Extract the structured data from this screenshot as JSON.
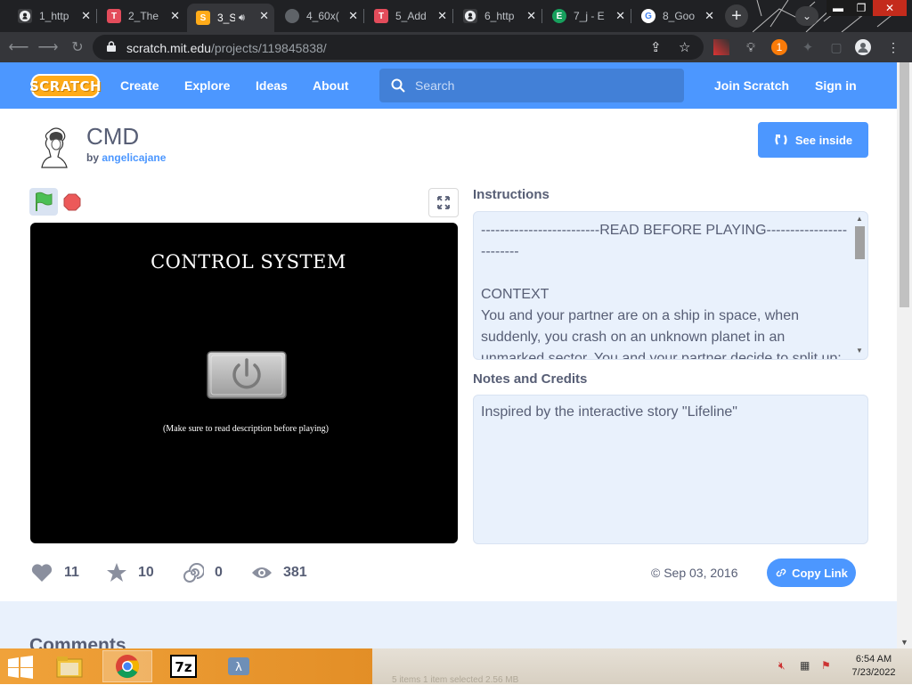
{
  "browser": {
    "tabs": [
      {
        "title": "1_http",
        "favicon": "github-icon",
        "color": "#3c3d40"
      },
      {
        "title": "2_The",
        "favicon": "T",
        "color": "#e34c5b"
      },
      {
        "title": "3_S",
        "favicon": "S",
        "color": "#ffab19",
        "active": true,
        "audio": true
      },
      {
        "title": "4_60x(",
        "favicon": "",
        "color": "#5f6368"
      },
      {
        "title": "5_Add",
        "favicon": "T",
        "color": "#e34c5b"
      },
      {
        "title": "6_http",
        "favicon": "github-icon",
        "color": "#3c3d40"
      },
      {
        "title": "7_j - E",
        "favicon": "E",
        "color": "#17a05d"
      },
      {
        "title": "8_Goo",
        "favicon": "G",
        "color": "#ffffff"
      }
    ],
    "url_host": "scratch.mit.edu",
    "url_path": "/projects/119845838/",
    "extension_badge": "1"
  },
  "scratch_nav": {
    "logo": "SCRATCH",
    "links": [
      "Create",
      "Explore",
      "Ideas",
      "About"
    ],
    "search_placeholder": "Search",
    "join": "Join Scratch",
    "signin": "Sign in"
  },
  "project": {
    "title": "CMD",
    "by_label": "by",
    "author": "angelicajane",
    "see_inside": "See inside",
    "stage": {
      "title": "CONTROL SYSTEM",
      "note": "(Make sure to read description before playing)"
    },
    "instructions_heading": "Instructions",
    "instructions": [
      "-------------------------READ BEFORE PLAYING-------------------------",
      "",
      "CONTEXT",
      "You and your partner are on a ship in space, when suddenly, you crash on an unknown planet in an unmarked sector. You and your partner decide to split up:"
    ],
    "notes_heading": "Notes and Credits",
    "notes": "Inspired by the interactive story \"Lifeline\"",
    "stats": {
      "loves": "11",
      "favorites": "10",
      "remixes": "0",
      "views": "381"
    },
    "date": "© Sep 03, 2016",
    "copy_link": "Copy Link",
    "comments_heading": "Comments"
  },
  "taskbar": {
    "time": "6:54 AM",
    "date": "7/23/2022",
    "status_fragment": "5 items    1 item selected  2.56 MB"
  },
  "colors": {
    "scratch_blue": "#4c97ff",
    "scratch_text": "#575e75",
    "panel_bg": "#e9f1fc"
  }
}
